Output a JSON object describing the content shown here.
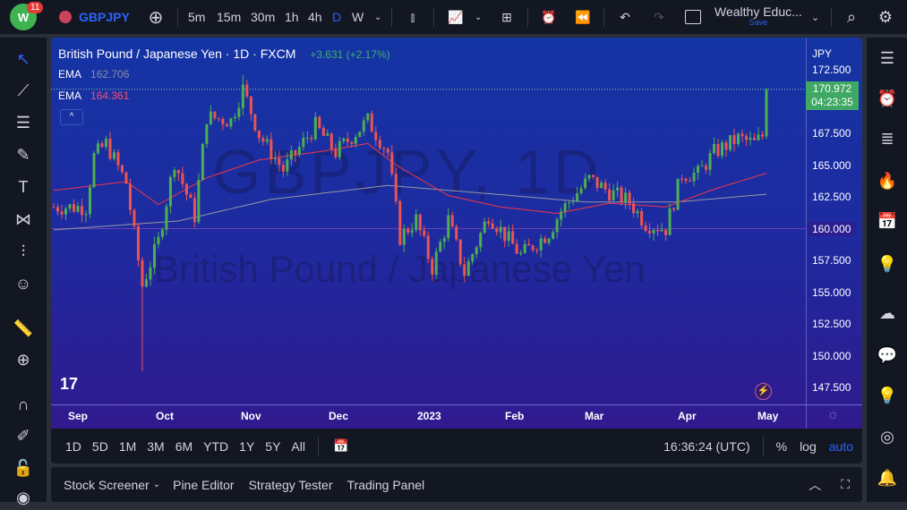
{
  "topbar": {
    "notification_count": "11",
    "symbol": "GBPJPY",
    "intervals": [
      "5m",
      "15m",
      "30m",
      "1h",
      "4h",
      "D",
      "W"
    ],
    "active_interval": "D",
    "layout_name": "Wealthy Educ...",
    "save_label": "Save"
  },
  "chart": {
    "title": "British Pound / Japanese Yen · 1D · FXCM",
    "change": "+3.631 (+2.17%)",
    "ema1_label": "EMA",
    "ema1_value": "162.706",
    "ema2_label": "EMA",
    "ema2_value": "164.361",
    "watermark_symbol": "GBPJPY, 1D",
    "watermark_name": "British Pound / Japanese Yen",
    "currency": "JPY",
    "current_price": "170.972",
    "countdown": "04:23:35",
    "highlight_level": "160.000",
    "price_ticks": [
      "172.500",
      "167.500",
      "165.000",
      "162.500",
      "157.500",
      "155.000",
      "152.500",
      "150.000",
      "147.500"
    ],
    "time_ticks": [
      "Sep",
      "Oct",
      "Nov",
      "Dec",
      "2023",
      "Feb",
      "Mar",
      "Apr",
      "May"
    ],
    "colors": {
      "up": "#26a69a",
      "up_candle": "#4caf50",
      "down": "#ef5350",
      "ema_fast": "#f23645",
      "ema_slow": "#9598a1",
      "bg_top": "#1434a4",
      "bg_bottom": "#301a8e"
    }
  },
  "chart_data": {
    "type": "candlestick",
    "title": "British Pound / Japanese Yen · 1D · FXCM",
    "ylim": [
      146.5,
      174.5
    ],
    "bars": 178,
    "close_anchors": [
      [
        0,
        161.7
      ],
      [
        8,
        161.7
      ],
      [
        10,
        165.7
      ],
      [
        13,
        166.7
      ],
      [
        18,
        163.6
      ],
      [
        22,
        155.5
      ],
      [
        26,
        159
      ],
      [
        30,
        165.3
      ],
      [
        35,
        161
      ],
      [
        38,
        168.8
      ],
      [
        44,
        168.5
      ],
      [
        47,
        171
      ],
      [
        51,
        167.4
      ],
      [
        57,
        164.6
      ],
      [
        65,
        168.1
      ],
      [
        70,
        166
      ],
      [
        78,
        168.5
      ],
      [
        83,
        166
      ],
      [
        86,
        159.3
      ],
      [
        90,
        160.7
      ],
      [
        94,
        156.9
      ],
      [
        98,
        160.7
      ],
      [
        102,
        156.5
      ],
      [
        108,
        161.1
      ],
      [
        116,
        157.9
      ],
      [
        123,
        159.7
      ],
      [
        126,
        161.4
      ],
      [
        133,
        163.9
      ],
      [
        138,
        162.9
      ],
      [
        143,
        162.1
      ],
      [
        147,
        160.4
      ],
      [
        152,
        160
      ],
      [
        156,
        164.3
      ],
      [
        160,
        164.3
      ],
      [
        164,
        166
      ],
      [
        170,
        167.1
      ],
      [
        174,
        166.7
      ],
      [
        176,
        167.3
      ],
      [
        177,
        170.972
      ]
    ],
    "wick_extremes": [
      [
        22,
        148.8
      ],
      [
        47,
        172.1
      ]
    ],
    "ema_fast": [
      [
        0,
        163
      ],
      [
        18,
        163.7
      ],
      [
        26,
        161.9
      ],
      [
        38,
        164
      ],
      [
        51,
        165.4
      ],
      [
        67,
        166.1
      ],
      [
        78,
        166.7
      ],
      [
        85,
        165
      ],
      [
        98,
        162.6
      ],
      [
        111,
        161.7
      ],
      [
        125,
        161.2
      ],
      [
        138,
        162
      ],
      [
        152,
        161.7
      ],
      [
        164,
        163.1
      ],
      [
        177,
        164.361
      ]
    ],
    "ema_slow": [
      [
        0,
        159.9
      ],
      [
        31,
        160.6
      ],
      [
        54,
        162.3
      ],
      [
        83,
        163.4
      ],
      [
        110,
        162.7
      ],
      [
        132,
        162.1
      ],
      [
        155,
        162.1
      ],
      [
        177,
        162.706
      ]
    ]
  },
  "rangebar": {
    "ranges": [
      "1D",
      "5D",
      "1M",
      "3M",
      "6M",
      "YTD",
      "1Y",
      "5Y",
      "All"
    ],
    "time": "16:36:24 (UTC)",
    "pct": "%",
    "log": "log",
    "auto": "auto"
  },
  "bottom": {
    "tabs": [
      "Stock Screener",
      "Pine Editor",
      "Strategy Tester",
      "Trading Panel"
    ]
  }
}
